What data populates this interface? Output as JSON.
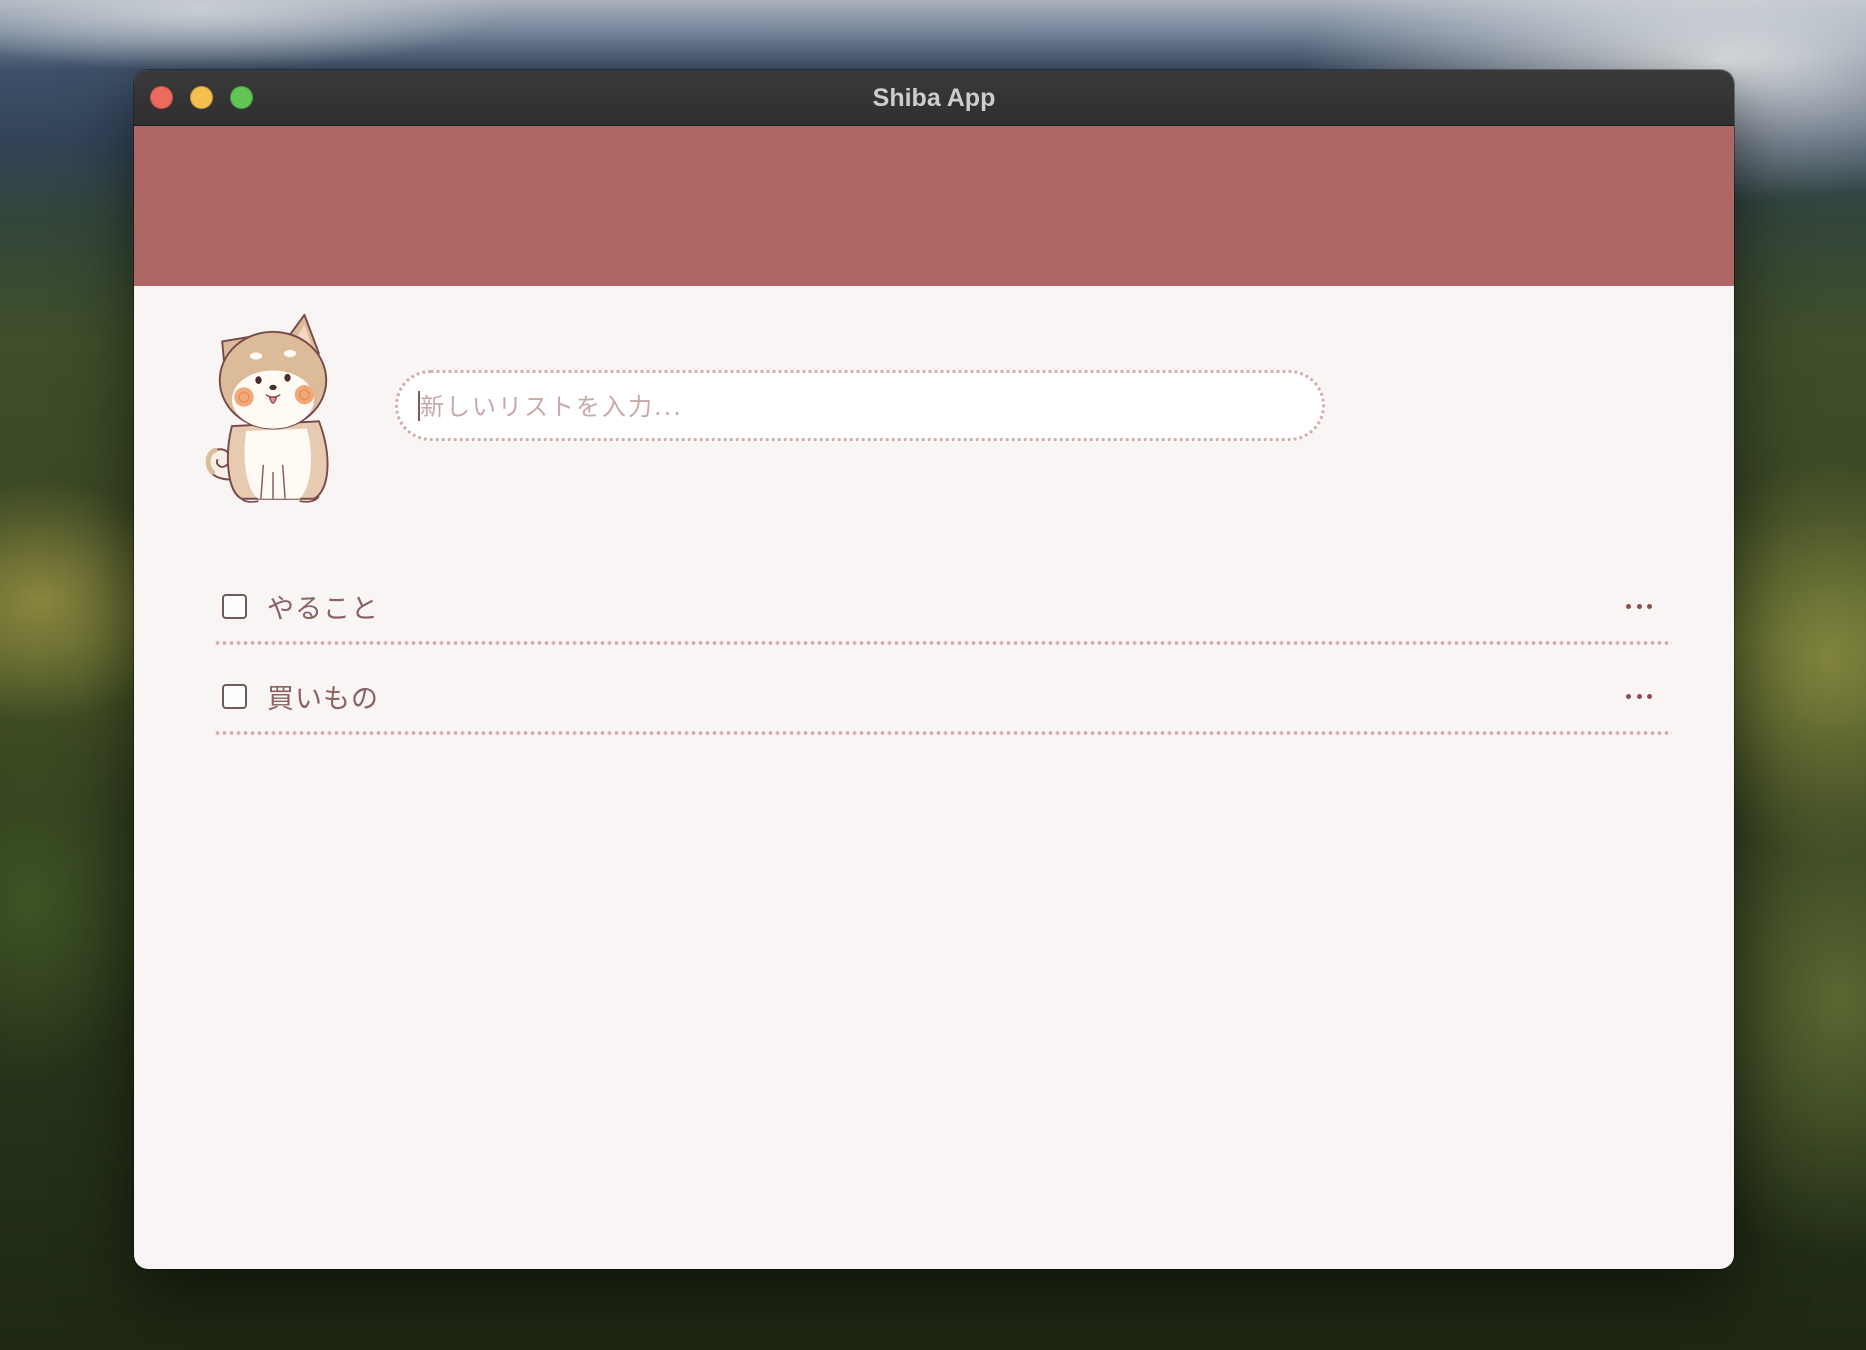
{
  "window": {
    "title": "Shiba App",
    "controls": [
      {
        "name": "close",
        "color": "#ed6a5e"
      },
      {
        "name": "minimize",
        "color": "#f5bf4f"
      },
      {
        "name": "zoom",
        "color": "#61c554"
      }
    ]
  },
  "theme": {
    "header_color": "#af6766",
    "content_bg": "#faf5f5",
    "text_color": "#8a6262",
    "dotted_color": "#d6adad"
  },
  "illustration": {
    "icon": "shiba-dog-illustration"
  },
  "new_list_input": {
    "placeholder": "新しいリストを入力...",
    "value": ""
  },
  "lists": [
    {
      "label": "やること",
      "checked": false,
      "menu_icon": "more-horizontal-icon"
    },
    {
      "label": "買いもの",
      "checked": false,
      "menu_icon": "more-horizontal-icon"
    }
  ]
}
